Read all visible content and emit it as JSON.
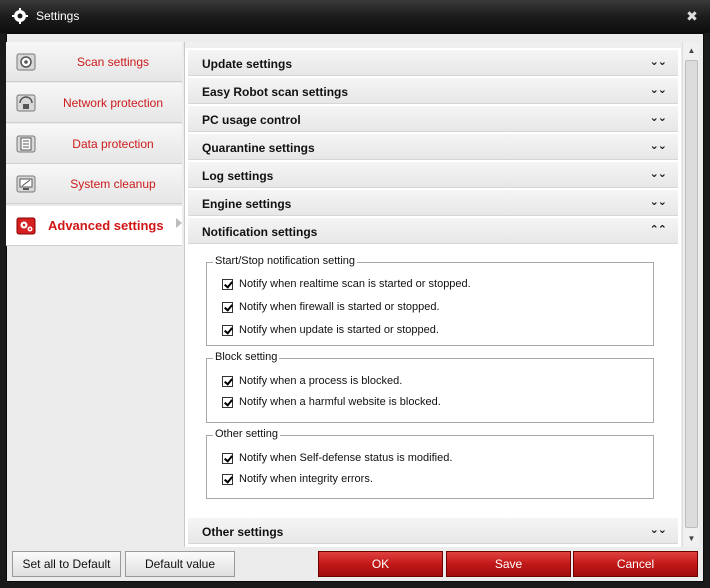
{
  "window": {
    "title": "Settings",
    "close_glyph": "✖"
  },
  "sidebar": {
    "items": [
      {
        "label": "Scan settings",
        "icon": "gear-icon",
        "active": false
      },
      {
        "label": "Network protection",
        "icon": "network-icon",
        "active": false
      },
      {
        "label": "Data protection",
        "icon": "document-icon",
        "active": false
      },
      {
        "label": "System cleanup",
        "icon": "monitor-icon",
        "active": false
      },
      {
        "label": "Advanced settings",
        "icon": "gears-icon",
        "active": true
      }
    ]
  },
  "sections": [
    {
      "label": "Update settings",
      "expanded": false
    },
    {
      "label": "Easy Robot scan settings",
      "expanded": false
    },
    {
      "label": "PC usage control",
      "expanded": false
    },
    {
      "label": "Quarantine settings",
      "expanded": false
    },
    {
      "label": "Log settings",
      "expanded": false
    },
    {
      "label": "Engine settings",
      "expanded": false
    },
    {
      "label": "Notification settings",
      "expanded": true
    },
    {
      "label": "Other settings",
      "expanded": false
    }
  ],
  "notification": {
    "groups": [
      {
        "legend": "Start/Stop notification setting",
        "options": [
          {
            "label": "Notify when realtime scan is started or stopped.",
            "checked": true
          },
          {
            "label": "Notify when firewall is started or stopped.",
            "checked": true
          },
          {
            "label": "Notify when update is started or stopped.",
            "checked": true
          }
        ]
      },
      {
        "legend": "Block setting",
        "options": [
          {
            "label": "Notify when a process is blocked.",
            "checked": true
          },
          {
            "label": "Notify when a harmful website is blocked.",
            "checked": true
          }
        ]
      },
      {
        "legend": "Other setting",
        "options": [
          {
            "label": "Notify when Self-defense status is modified.",
            "checked": true
          },
          {
            "label": "Notify when integrity errors.",
            "checked": true
          }
        ]
      }
    ]
  },
  "chevrons": {
    "collapsed": "⌄⌄",
    "expanded": "⌃⌃"
  },
  "scrollbar": {
    "up": "▲",
    "down": "▼"
  },
  "footer": {
    "set_all_default": "Set all to Default",
    "default_value": "Default value",
    "ok": "OK",
    "save": "Save",
    "cancel": "Cancel"
  },
  "colors": {
    "accent": "#cc1a1a",
    "titlebar": "#1c1c1c"
  }
}
